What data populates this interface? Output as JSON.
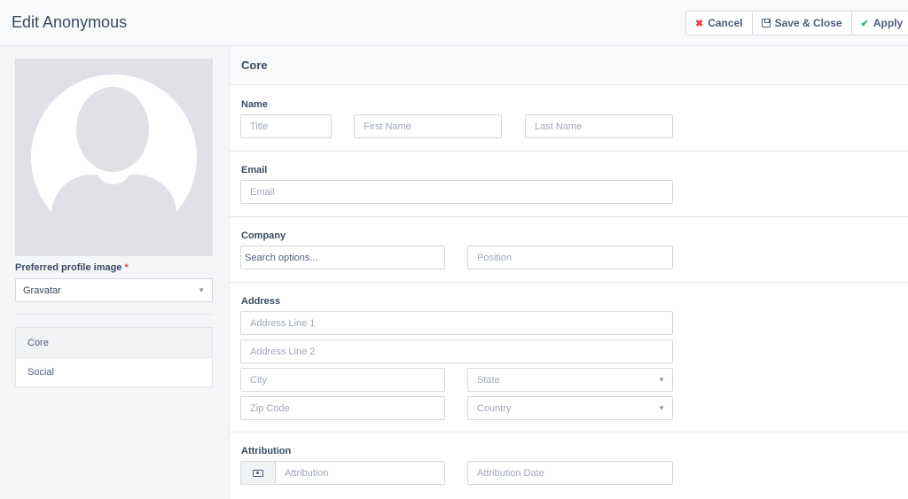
{
  "header": {
    "title": "Edit Anonymous",
    "cancel_label": "Cancel",
    "save_close_label": "Save & Close",
    "apply_label": "Apply"
  },
  "left": {
    "pref_label": "Preferred profile image",
    "pref_required": "*",
    "pref_value": "Gravatar",
    "nav": [
      "Core",
      "Social"
    ]
  },
  "main": {
    "section_title": "Core",
    "name": {
      "label": "Name",
      "title_ph": "Title",
      "first_ph": "First Name",
      "last_ph": "Last Name"
    },
    "email": {
      "label": "Email",
      "email_ph": "Email"
    },
    "company": {
      "label": "Company",
      "company_ph": "Search options...",
      "position_ph": "Position"
    },
    "address": {
      "label": "Address",
      "line1_ph": "Address Line 1",
      "line2_ph": "Address Line 2",
      "city_ph": "City",
      "state_ph": "State",
      "zip_ph": "Zip Code",
      "country_ph": "Country"
    },
    "attribution": {
      "label": "Attribution",
      "attr_ph": "Attribution",
      "date_ph": "Attribution Date"
    }
  },
  "icons": {
    "cancel": "times-icon",
    "save": "save-icon",
    "apply": "check-icon",
    "attribution": "money-icon"
  },
  "colors": {
    "danger": "#e8434b",
    "success": "#35b37e"
  }
}
